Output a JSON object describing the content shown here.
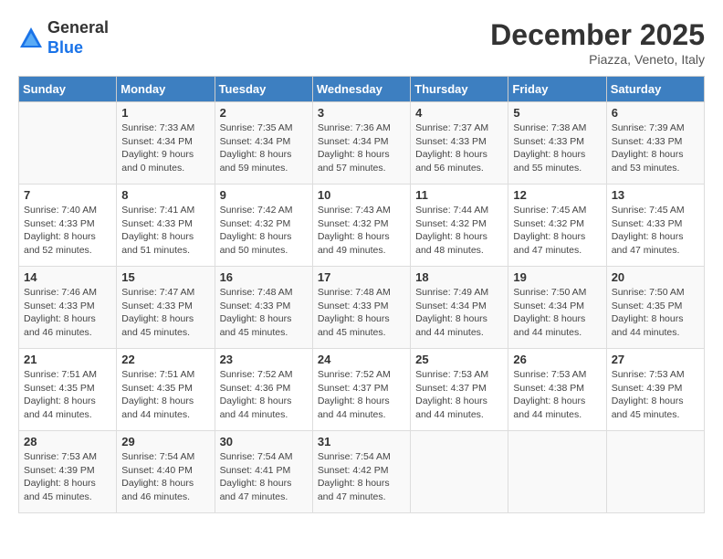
{
  "header": {
    "logo_general": "General",
    "logo_blue": "Blue",
    "month_title": "December 2025",
    "location": "Piazza, Veneto, Italy"
  },
  "weekdays": [
    "Sunday",
    "Monday",
    "Tuesday",
    "Wednesday",
    "Thursday",
    "Friday",
    "Saturday"
  ],
  "weeks": [
    [
      {
        "day": "",
        "info": ""
      },
      {
        "day": "1",
        "info": "Sunrise: 7:33 AM\nSunset: 4:34 PM\nDaylight: 9 hours\nand 0 minutes."
      },
      {
        "day": "2",
        "info": "Sunrise: 7:35 AM\nSunset: 4:34 PM\nDaylight: 8 hours\nand 59 minutes."
      },
      {
        "day": "3",
        "info": "Sunrise: 7:36 AM\nSunset: 4:34 PM\nDaylight: 8 hours\nand 57 minutes."
      },
      {
        "day": "4",
        "info": "Sunrise: 7:37 AM\nSunset: 4:33 PM\nDaylight: 8 hours\nand 56 minutes."
      },
      {
        "day": "5",
        "info": "Sunrise: 7:38 AM\nSunset: 4:33 PM\nDaylight: 8 hours\nand 55 minutes."
      },
      {
        "day": "6",
        "info": "Sunrise: 7:39 AM\nSunset: 4:33 PM\nDaylight: 8 hours\nand 53 minutes."
      }
    ],
    [
      {
        "day": "7",
        "info": "Sunrise: 7:40 AM\nSunset: 4:33 PM\nDaylight: 8 hours\nand 52 minutes."
      },
      {
        "day": "8",
        "info": "Sunrise: 7:41 AM\nSunset: 4:33 PM\nDaylight: 8 hours\nand 51 minutes."
      },
      {
        "day": "9",
        "info": "Sunrise: 7:42 AM\nSunset: 4:32 PM\nDaylight: 8 hours\nand 50 minutes."
      },
      {
        "day": "10",
        "info": "Sunrise: 7:43 AM\nSunset: 4:32 PM\nDaylight: 8 hours\nand 49 minutes."
      },
      {
        "day": "11",
        "info": "Sunrise: 7:44 AM\nSunset: 4:32 PM\nDaylight: 8 hours\nand 48 minutes."
      },
      {
        "day": "12",
        "info": "Sunrise: 7:45 AM\nSunset: 4:32 PM\nDaylight: 8 hours\nand 47 minutes."
      },
      {
        "day": "13",
        "info": "Sunrise: 7:45 AM\nSunset: 4:33 PM\nDaylight: 8 hours\nand 47 minutes."
      }
    ],
    [
      {
        "day": "14",
        "info": "Sunrise: 7:46 AM\nSunset: 4:33 PM\nDaylight: 8 hours\nand 46 minutes."
      },
      {
        "day": "15",
        "info": "Sunrise: 7:47 AM\nSunset: 4:33 PM\nDaylight: 8 hours\nand 45 minutes."
      },
      {
        "day": "16",
        "info": "Sunrise: 7:48 AM\nSunset: 4:33 PM\nDaylight: 8 hours\nand 45 minutes."
      },
      {
        "day": "17",
        "info": "Sunrise: 7:48 AM\nSunset: 4:33 PM\nDaylight: 8 hours\nand 45 minutes."
      },
      {
        "day": "18",
        "info": "Sunrise: 7:49 AM\nSunset: 4:34 PM\nDaylight: 8 hours\nand 44 minutes."
      },
      {
        "day": "19",
        "info": "Sunrise: 7:50 AM\nSunset: 4:34 PM\nDaylight: 8 hours\nand 44 minutes."
      },
      {
        "day": "20",
        "info": "Sunrise: 7:50 AM\nSunset: 4:35 PM\nDaylight: 8 hours\nand 44 minutes."
      }
    ],
    [
      {
        "day": "21",
        "info": "Sunrise: 7:51 AM\nSunset: 4:35 PM\nDaylight: 8 hours\nand 44 minutes."
      },
      {
        "day": "22",
        "info": "Sunrise: 7:51 AM\nSunset: 4:35 PM\nDaylight: 8 hours\nand 44 minutes."
      },
      {
        "day": "23",
        "info": "Sunrise: 7:52 AM\nSunset: 4:36 PM\nDaylight: 8 hours\nand 44 minutes."
      },
      {
        "day": "24",
        "info": "Sunrise: 7:52 AM\nSunset: 4:37 PM\nDaylight: 8 hours\nand 44 minutes."
      },
      {
        "day": "25",
        "info": "Sunrise: 7:53 AM\nSunset: 4:37 PM\nDaylight: 8 hours\nand 44 minutes."
      },
      {
        "day": "26",
        "info": "Sunrise: 7:53 AM\nSunset: 4:38 PM\nDaylight: 8 hours\nand 44 minutes."
      },
      {
        "day": "27",
        "info": "Sunrise: 7:53 AM\nSunset: 4:39 PM\nDaylight: 8 hours\nand 45 minutes."
      }
    ],
    [
      {
        "day": "28",
        "info": "Sunrise: 7:53 AM\nSunset: 4:39 PM\nDaylight: 8 hours\nand 45 minutes."
      },
      {
        "day": "29",
        "info": "Sunrise: 7:54 AM\nSunset: 4:40 PM\nDaylight: 8 hours\nand 46 minutes."
      },
      {
        "day": "30",
        "info": "Sunrise: 7:54 AM\nSunset: 4:41 PM\nDaylight: 8 hours\nand 47 minutes."
      },
      {
        "day": "31",
        "info": "Sunrise: 7:54 AM\nSunset: 4:42 PM\nDaylight: 8 hours\nand 47 minutes."
      },
      {
        "day": "",
        "info": ""
      },
      {
        "day": "",
        "info": ""
      },
      {
        "day": "",
        "info": ""
      }
    ]
  ]
}
